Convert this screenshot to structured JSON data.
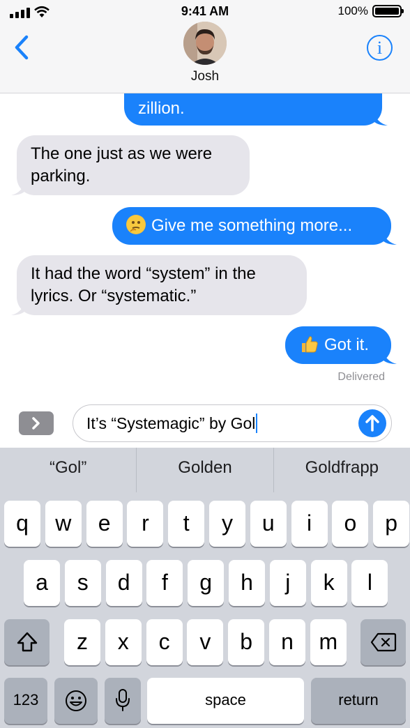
{
  "status_bar": {
    "time": "9:41 AM",
    "battery": "100%",
    "battery_level": 1.0
  },
  "header": {
    "contact_name": "Josh",
    "info_symbol": "i"
  },
  "messages": [
    {
      "direction": "outgoing",
      "text": "zillion."
    },
    {
      "direction": "incoming",
      "lines": [
        "The one just as we were",
        "parking."
      ]
    },
    {
      "direction": "outgoing",
      "emoji": "thinking-face-emoji",
      "text": "Give me something more..."
    },
    {
      "direction": "incoming",
      "lines": [
        "It had the word “system” in the",
        "lyrics. Or “systematic.”"
      ]
    },
    {
      "direction": "outgoing",
      "emoji": "thumbs-up-emoji",
      "text": "Got it."
    }
  ],
  "delivery_status": "Delivered",
  "compose": {
    "value": "It’s “Systemagic” by Gol"
  },
  "keyboard": {
    "suggestions": [
      "“Gol”",
      "Golden",
      "Goldfrapp"
    ],
    "row1": [
      "q",
      "w",
      "e",
      "r",
      "t",
      "y",
      "u",
      "i",
      "o",
      "p"
    ],
    "row2": [
      "a",
      "s",
      "d",
      "f",
      "g",
      "h",
      "j",
      "k",
      "l"
    ],
    "row3": [
      "z",
      "x",
      "c",
      "v",
      "b",
      "n",
      "m"
    ],
    "numbers_label": "123",
    "space_label": "space",
    "return_label": "return"
  },
  "colors": {
    "accent": "#1a82fb",
    "incoming_bubble": "#e6e5eb",
    "keyboard_bg": "#d2d5dc",
    "dark_key": "#abb1bb"
  }
}
